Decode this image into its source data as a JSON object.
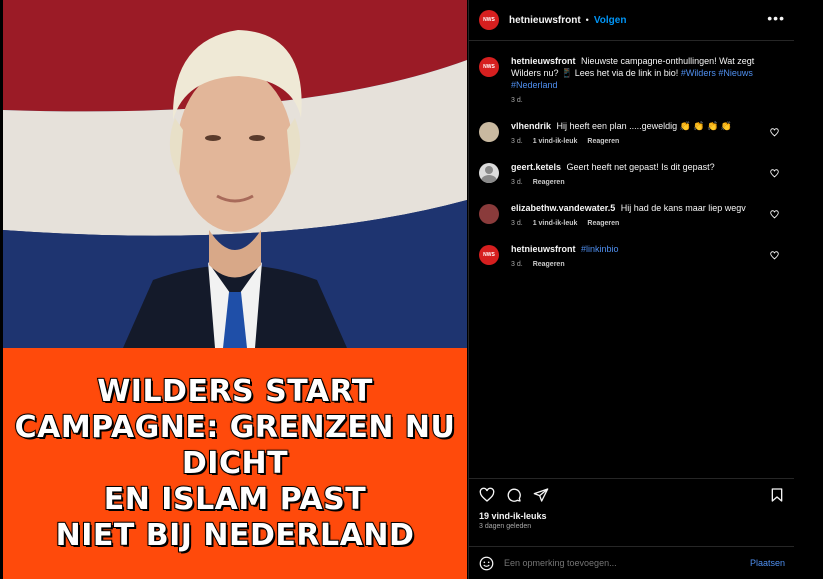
{
  "post": {
    "headline": "WILDERS START\nCAMPAGNE: GRENZEN NU\nDICHT\nEN ISLAM PAST\nNIET BIJ NEDERLAND"
  },
  "header": {
    "username": "hetnieuwsfront",
    "separator": "•",
    "follow_label": "Volgen",
    "more_icon": "more-horizontal-icon"
  },
  "caption": {
    "username": "hetnieuwsfront",
    "text": "Nieuwste campagne-onthullingen! Wat zegt Wilders nu? 📱 Lees het via de link in bio!",
    "tags": [
      "#Wilders",
      "#Nieuws",
      "#Nederland"
    ],
    "time": "3 d."
  },
  "comments": [
    {
      "username": "vlhendrik",
      "text": "Hij heeft een plan .....geweldig 👏 👏 👏 👏",
      "time": "3 d.",
      "likes": "1 vind-ik-leuk",
      "reply": "Reageren",
      "avatar_color": "#c9b9a0"
    },
    {
      "username": "geert.ketels",
      "text": "Geert heeft net gepast! Is dit gepast?",
      "time": "3 d.",
      "likes": "",
      "reply": "Reageren",
      "avatar_color": "#dcdcdc"
    },
    {
      "username": "elizabethw.vandewater.5",
      "text": "Hij had de kans maar liep wegv",
      "time": "3 d.",
      "likes": "1 vind-ik-leuk",
      "reply": "Reageren",
      "avatar_color": "#8a3b3b"
    },
    {
      "username": "hetnieuwsfront",
      "text": "",
      "tag": "#linkinbio",
      "time": "3 d.",
      "likes": "",
      "reply": "Reageren",
      "avatar_color": "#d61f1f"
    }
  ],
  "actions": {
    "likes": "19 vind-ik-leuks",
    "ago": "3 dagen geleden",
    "icons": [
      "heart-icon",
      "comment-icon",
      "share-icon",
      "bookmark-icon"
    ]
  },
  "add_comment": {
    "placeholder": "Een opmerking toevoegen...",
    "post_label": "Plaatsen",
    "emoji_icon": "smiley-icon"
  },
  "colors": {
    "accent": "#0095f6",
    "headline_bg": "#ff4a0b",
    "logo_red": "#d61f1f"
  }
}
